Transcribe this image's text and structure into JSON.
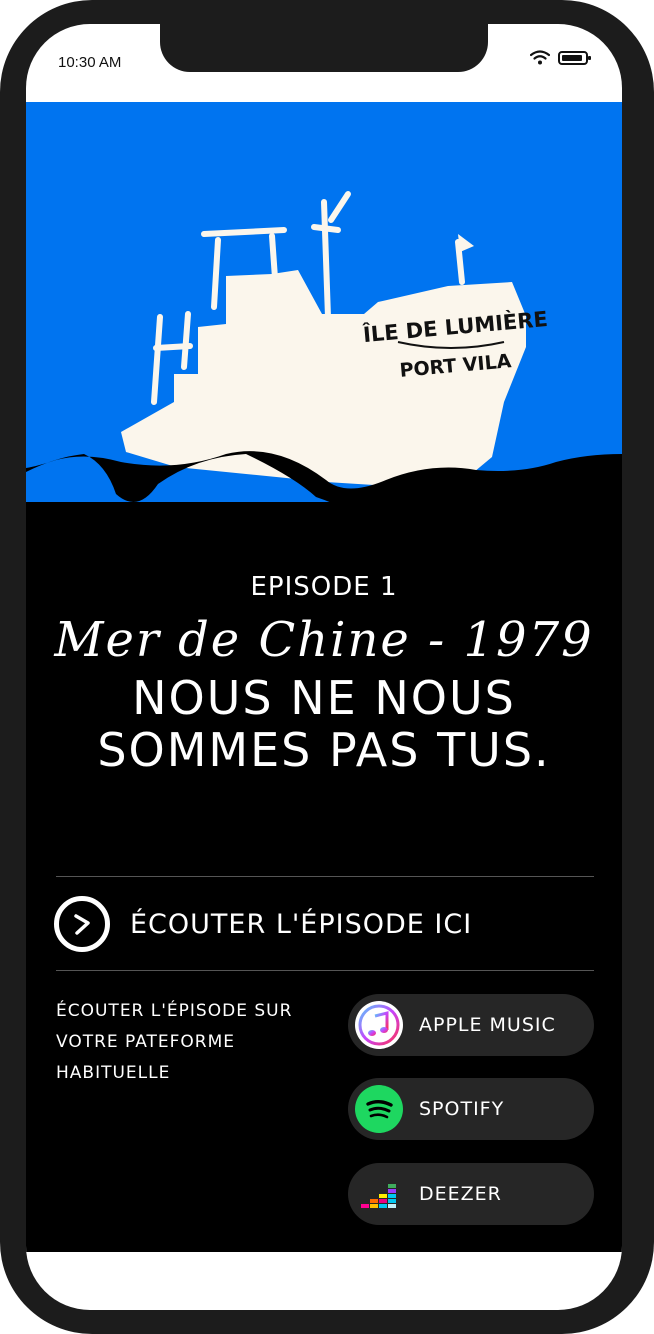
{
  "status_bar": {
    "time": "10:30 AM"
  },
  "hero": {
    "boat_name": "ÎLE DE LUMIÈRE",
    "boat_port": "PORT VILA"
  },
  "episode": {
    "label": "EPISODE 1",
    "subtitle": "Mer de Chine - 1979",
    "title_line1": "NOUS NE NOUS",
    "title_line2": "SOMMES PAS TUS."
  },
  "listen": {
    "label": "ÉCOUTER L'ÉPISODE ICI"
  },
  "platforms": {
    "intro_line1": "ÉCOUTER L'ÉPISODE SUR",
    "intro_line2": "VOTRE PATEFORME",
    "intro_line3": "HABITUELLE",
    "items": [
      {
        "label": "APPLE MUSIC",
        "icon": "apple-music-icon"
      },
      {
        "label": "SPOTIFY",
        "icon": "spotify-icon"
      },
      {
        "label": "DEEZER",
        "icon": "deezer-icon"
      }
    ]
  },
  "colors": {
    "sky": "#0074f0",
    "boat": "#fbf6ec",
    "background": "#000000",
    "spotify": "#1ed760"
  }
}
